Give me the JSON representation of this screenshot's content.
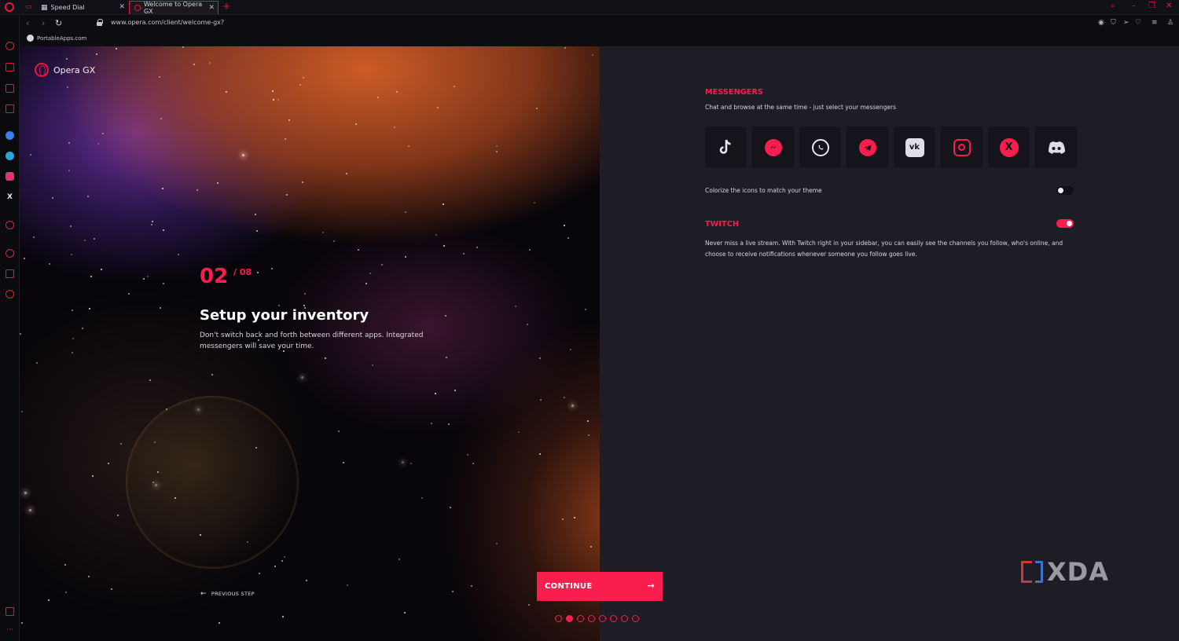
{
  "tabs": [
    {
      "label": "Speed Dial"
    },
    {
      "label": "Welcome to Opera GX"
    }
  ],
  "address": {
    "url": "www.opera.com/client/welcome-gx?"
  },
  "bookmarks": [
    {
      "label": "PortableApps.com"
    }
  ],
  "hero": {
    "brand": "Opera GX",
    "step": "02",
    "step_total": "/ 08",
    "title": "Setup your inventory",
    "description": "Don't switch back and forth between different apps. Integrated messengers will save your time.",
    "previous": "PREVIOUS STEP"
  },
  "continue_label": "CONTINUE",
  "pagination": {
    "total": 8,
    "current": 2
  },
  "messengers": {
    "title": "MESSENGERS",
    "subtitle": "Chat and browse at the same time - just select your messengers",
    "apps": [
      "tiktok",
      "messenger",
      "whatsapp",
      "telegram",
      "vk",
      "instagram",
      "x",
      "discord"
    ],
    "colorize_label": "Colorize the icons to match your theme",
    "colorize_enabled": false
  },
  "twitch": {
    "title": "TWITCH",
    "enabled": true,
    "description": "Never miss a live stream. With Twitch right in your sidebar, you can easily see the channels you follow, who's online, and choose to receive notifications whenever someone you follow goes live."
  },
  "watermark": "XDA",
  "colors": {
    "accent": "#fa1e4e",
    "panel": "#1e1c25",
    "tile": "#15141a"
  }
}
